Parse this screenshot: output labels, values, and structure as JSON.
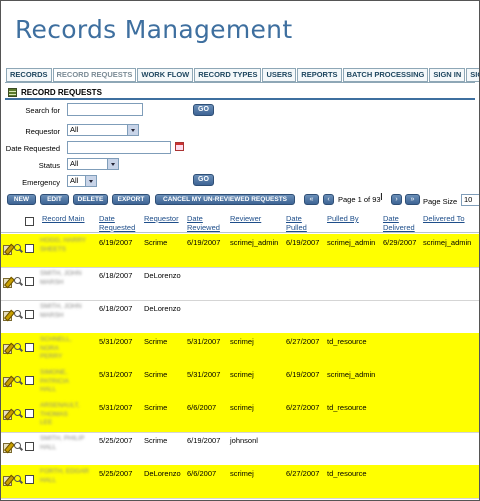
{
  "app": {
    "title": "Records Management"
  },
  "tabs": [
    {
      "label": "RECORDS"
    },
    {
      "label": "RECORD REQUESTS",
      "active": true
    },
    {
      "label": "WORK FLOW"
    },
    {
      "label": "RECORD TYPES"
    },
    {
      "label": "USERS"
    },
    {
      "label": "REPORTS"
    },
    {
      "label": "BATCH PROCESSING"
    },
    {
      "label": "SIGN IN"
    },
    {
      "label": "SIGN OUT"
    }
  ],
  "section": {
    "title": "RECORD REQUESTS"
  },
  "filters": {
    "search_label": "Search for",
    "search_value": "",
    "requestor_label": "Requestor",
    "requestor_value": "All",
    "date_label": "Date Requested",
    "date_value": "",
    "status_label": "Status",
    "status_value": "All",
    "emergency_label": "Emergency",
    "emergency_value": "All",
    "go_label": "GO"
  },
  "toolbar": {
    "new_label": "NEW",
    "edit_label": "EDIT",
    "delete_label": "DELETE",
    "export_label": "EXPORT",
    "cancel_label": "CANCEL MY UN-REVIEWED REQUESTS",
    "page_text": "Page 1 of 93",
    "page_size_label": "Page Size",
    "page_size_value": "10"
  },
  "columns": {
    "record_main": "Record Main",
    "date_requested": "Date Requested",
    "requestor": "Requestor",
    "date_reviewed": "Date Reviewed",
    "reviewer": "Reviewer",
    "date_pulled": "Date Pulled",
    "pulled_by": "Pulled By",
    "date_delivered": "Date Delivered",
    "delivered_to": "Delivered To"
  },
  "rows": [
    {
      "highlight": true,
      "record_main": "HOGG, HARRY\nSHEETS",
      "date_requested": "6/19/2007",
      "requestor": "Scrime",
      "date_reviewed": "6/19/2007",
      "reviewer": "scrimej_admin",
      "date_pulled": "6/19/2007",
      "pulled_by": "scrimej_admin",
      "date_delivered": "6/29/2007",
      "delivered_to": "scrimej_admin"
    },
    {
      "highlight": false,
      "record_main": "SMITH, JOHN\nMARSH",
      "date_requested": "6/18/2007",
      "requestor": "DeLorenzo",
      "date_reviewed": "",
      "reviewer": "",
      "date_pulled": "",
      "pulled_by": "",
      "date_delivered": "",
      "delivered_to": ""
    },
    {
      "highlight": false,
      "record_main": "SMITH, JOHN\nMARSH",
      "date_requested": "6/18/2007",
      "requestor": "DeLorenzo",
      "date_reviewed": "",
      "reviewer": "",
      "date_pulled": "",
      "pulled_by": "",
      "date_delivered": "",
      "delivered_to": ""
    },
    {
      "highlight": true,
      "record_main": "SCHNELL, NORA\nPERRY",
      "date_requested": "5/31/2007",
      "requestor": "Scrime",
      "date_reviewed": "5/31/2007",
      "reviewer": "scrimej",
      "date_pulled": "6/27/2007",
      "pulled_by": "td_resource",
      "date_delivered": "",
      "delivered_to": ""
    },
    {
      "highlight": true,
      "record_main": "SIMONE, PATRICIA\nHALL",
      "date_requested": "5/31/2007",
      "requestor": "Scrime",
      "date_reviewed": "5/31/2007",
      "reviewer": "scrimej",
      "date_pulled": "6/19/2007",
      "pulled_by": "scrimej_admin",
      "date_delivered": "",
      "delivered_to": ""
    },
    {
      "highlight": true,
      "record_main": "ARSENAULT, THOMAS\nLEE",
      "date_requested": "5/31/2007",
      "requestor": "Scrime",
      "date_reviewed": "6/6/2007",
      "reviewer": "scrimej",
      "date_pulled": "6/27/2007",
      "pulled_by": "td_resource",
      "date_delivered": "",
      "delivered_to": ""
    },
    {
      "highlight": false,
      "record_main": "SMITH, PHILIP\nHALL",
      "date_requested": "5/25/2007",
      "requestor": "Scrime",
      "date_reviewed": "6/19/2007",
      "reviewer": "johnsonl",
      "date_pulled": "",
      "pulled_by": "",
      "date_delivered": "",
      "delivered_to": ""
    },
    {
      "highlight": true,
      "record_main": "FORTH, EDGAR\nHALL",
      "date_requested": "5/25/2007",
      "requestor": "DeLorenzo",
      "date_reviewed": "6/6/2007",
      "reviewer": "scrimej",
      "date_pulled": "6/27/2007",
      "pulled_by": "td_resource",
      "date_delivered": "",
      "delivered_to": ""
    }
  ]
}
